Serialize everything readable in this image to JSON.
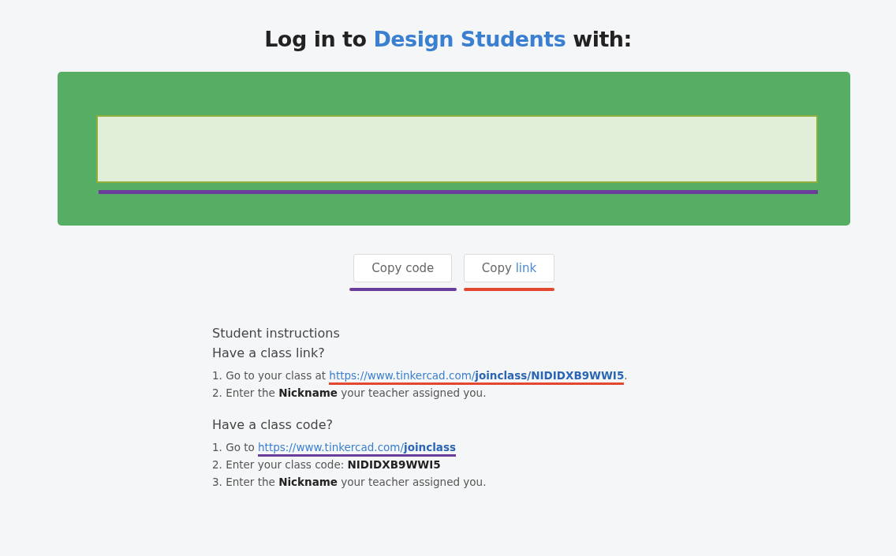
{
  "title": {
    "before": "Log in to ",
    "highlight": "Design Students",
    "after": " with:"
  },
  "code_panel": {
    "underline": {
      "color": "#6a3d9a"
    }
  },
  "buttons": [
    {
      "label": "Copy",
      "highlight": "code",
      "kind": "plain",
      "color": "#6a3d9a"
    },
    {
      "label": "Copy",
      "highlight": "link",
      "kind": "link",
      "color": "#e4472f"
    }
  ],
  "instructions": {
    "heading": "Student instructions",
    "sections": [
      {
        "title": "Have a class link?",
        "lines": [
          {
            "before": "1. Go to your class at ",
            "link": "https://www.tinkercad.com/**joinclass/NIDIDXB9WWI5**",
            "color": "#e4472f",
            "after": "."
          },
          {
            "before": "2. Enter the **Nickname** your teacher assigned you."
          }
        ]
      },
      {
        "title": "Have a class code?",
        "lines": [
          {
            "before": "1. Go to ",
            "link": "https://www.tinkercad.com/**joinclass**",
            "color": "#6a3d9a"
          },
          {
            "before": "2. Enter your class code: **NIDIDXB9WWI5**"
          },
          {
            "before": "3. Enter the **Nickname** your teacher assigned you."
          }
        ]
      }
    ]
  }
}
